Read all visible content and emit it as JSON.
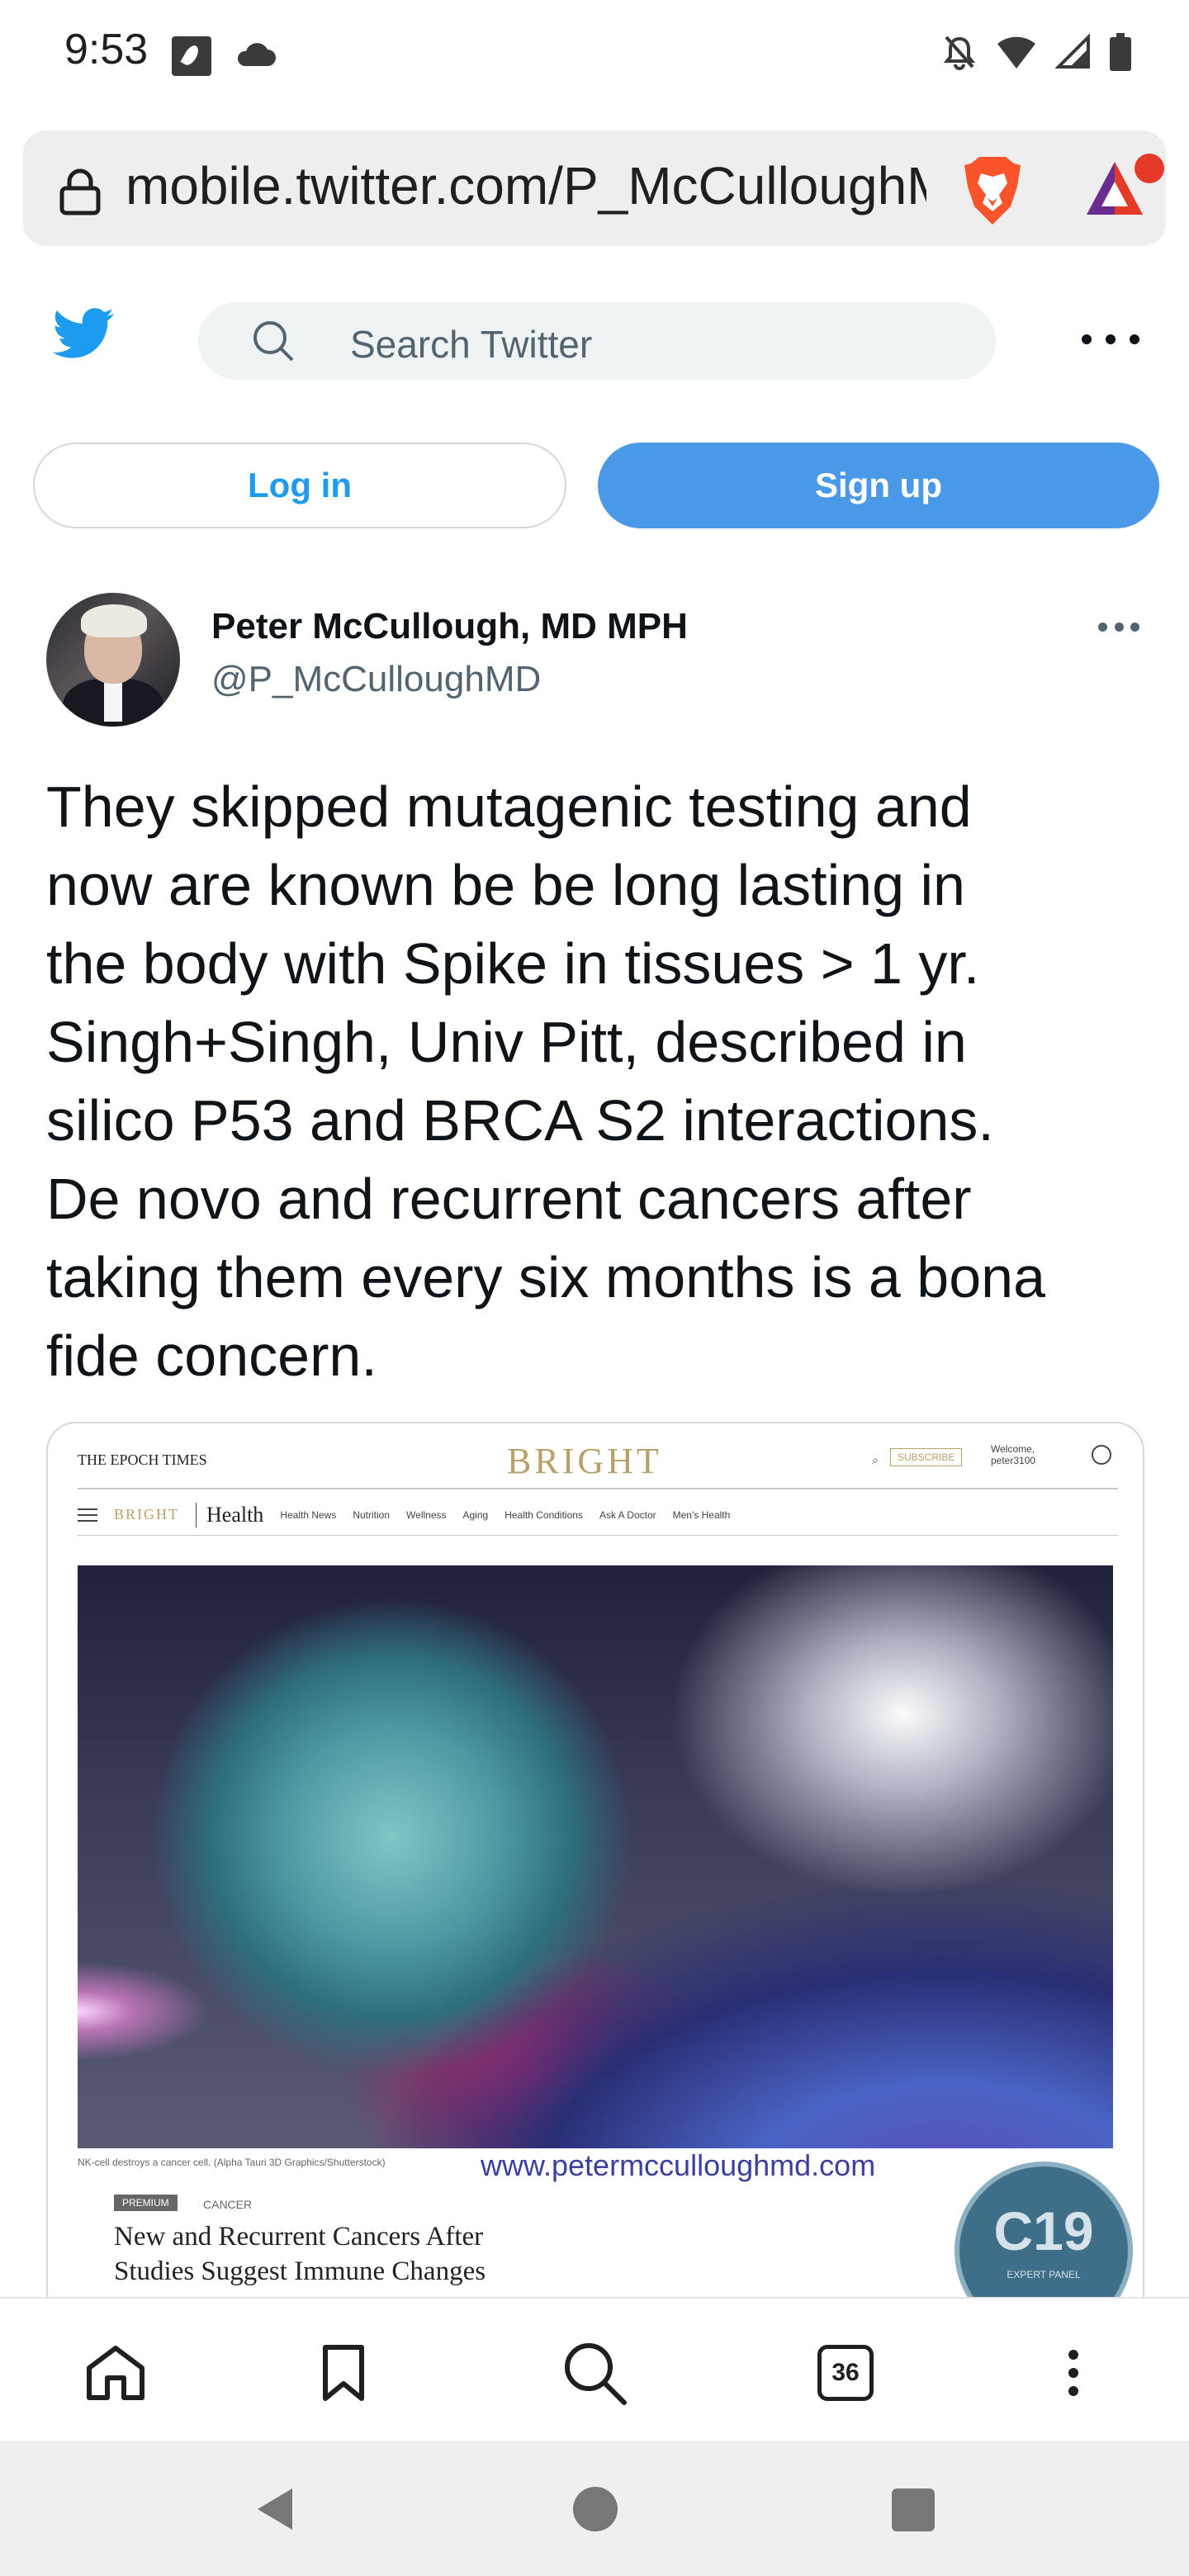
{
  "status_bar": {
    "time": "9:53"
  },
  "browser": {
    "url": "mobile.twitter.com/P_McCulloughMD"
  },
  "twitter_header": {
    "search_placeholder": "Search Twitter"
  },
  "auth": {
    "login_label": "Log in",
    "signup_label": "Sign up"
  },
  "tweet": {
    "display_name": "Peter McCullough, MD MPH",
    "handle": "@P_McCulloughMD",
    "text": "They skipped mutagenic testing and\nnow are known be be long lasting in\nthe body with Spike in tissues > 1 yr.\nSingh+Singh, Univ Pitt, described in\nsilico P53 and BRCA S2 interactions.\nDe novo and recurrent cancers after\ntaking them every six months is a bona\nfide concern."
  },
  "media": {
    "publisher": "THE EPOCH TIMES",
    "section_logo": "BRIGHT",
    "subscribe": "SUBSCRIBE",
    "welcome": "Welcome,\npeter3100",
    "nav_bright": "BRIGHT",
    "nav_health": "Health",
    "nav_items": [
      "Health News",
      "Nutrition",
      "Wellness",
      "Aging",
      "Health Conditions",
      "Ask A Doctor",
      "Men's Health"
    ],
    "caption": "NK-cell destroys a cancer cell. (Alpha Tauri 3D Graphics/Shutterstock)",
    "watermark": "www.petermcculloughmd.com",
    "badge": "PREMIUM",
    "category": "CANCER",
    "title": "New and Recurrent Cancers After\nStudies Suggest Immune Changes",
    "c19_text": "C19",
    "c19_sub": "EXPERT PANEL"
  },
  "toolbar": {
    "tabs_count": "36"
  },
  "icons": {
    "status": [
      "app-notification-icon",
      "cloud-icon",
      "bell-off-icon",
      "wifi-icon",
      "signal-icon",
      "battery-icon"
    ],
    "browser": [
      "lock-icon",
      "brave-lion-icon",
      "brave-rewards-icon"
    ],
    "toolbar": [
      "home-icon",
      "bookmark-icon",
      "search-icon",
      "tabs-icon",
      "menu-icon"
    ]
  },
  "colors": {
    "twitter_blue": "#1d9bf0",
    "signup_blue": "#4a99e9",
    "brave_orange": "#fb542b"
  }
}
